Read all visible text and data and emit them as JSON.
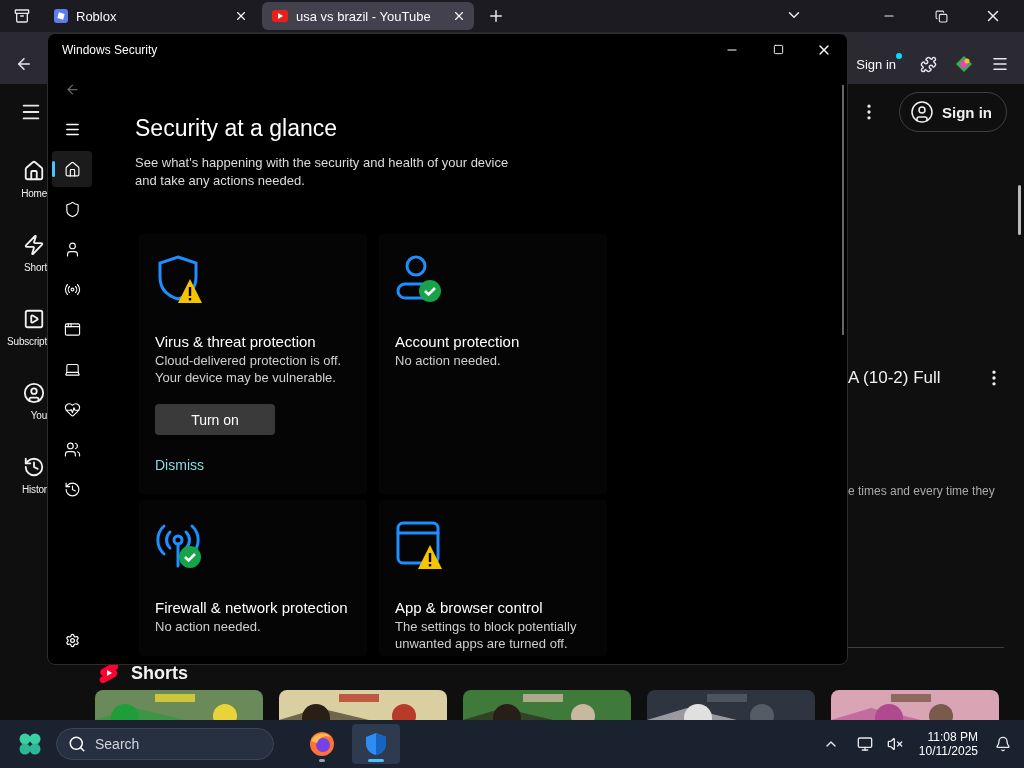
{
  "browser": {
    "tabs": [
      {
        "title": "Roblox",
        "selected": false,
        "kind": "roblox"
      },
      {
        "title": "usa vs brazil - YouTube",
        "selected": true,
        "kind": "youtube"
      }
    ],
    "toolbar": {
      "sign_in": "Sign in"
    }
  },
  "youtube": {
    "sidebar": [
      {
        "label": "Home",
        "kind": "home"
      },
      {
        "label": "Short",
        "kind": "shorts"
      },
      {
        "label": "Subscript",
        "kind": "subscriptions"
      },
      {
        "label": "You",
        "kind": "you"
      },
      {
        "label": "Histor",
        "kind": "history"
      }
    ],
    "sign_in": "Sign in",
    "video_title": "A (10-2) Full",
    "video_description": "e times and every time they",
    "shorts_heading": "Shorts"
  },
  "security_window": {
    "title": "Windows Security",
    "nav": [
      {
        "kind": "home",
        "selected": true
      },
      {
        "kind": "shield",
        "selected": false
      },
      {
        "kind": "account",
        "selected": false
      },
      {
        "kind": "firewall",
        "selected": false
      },
      {
        "kind": "app",
        "selected": false
      },
      {
        "kind": "device",
        "selected": false
      },
      {
        "kind": "health",
        "selected": false
      },
      {
        "kind": "family",
        "selected": false
      },
      {
        "kind": "history",
        "selected": false
      }
    ],
    "heading": "Security at a glance",
    "description": "See what's happening with the security and health of your device and take any actions needed.",
    "cards": [
      {
        "kind": "shield",
        "warning": true,
        "title": "Virus & threat protection",
        "description": "Cloud-delivered protection is off. Your device may be vulnerable.",
        "action": "Turn on",
        "dismiss": "Dismiss"
      },
      {
        "kind": "account",
        "warning": false,
        "title": "Account protection",
        "description": "No action needed."
      },
      {
        "kind": "firewall",
        "warning": false,
        "title": "Firewall & network protection",
        "description": "No action needed."
      },
      {
        "kind": "app",
        "warning": true,
        "title": "App & browser control",
        "description": "The settings to block potentially unwanted apps are turned off."
      }
    ]
  },
  "taskbar": {
    "placeholder": "Search",
    "apps": [
      {
        "kind": "firefox",
        "selected": false
      },
      {
        "kind": "security",
        "selected": true
      }
    ],
    "time": "11:08 PM",
    "date": "10/11/2025"
  }
}
